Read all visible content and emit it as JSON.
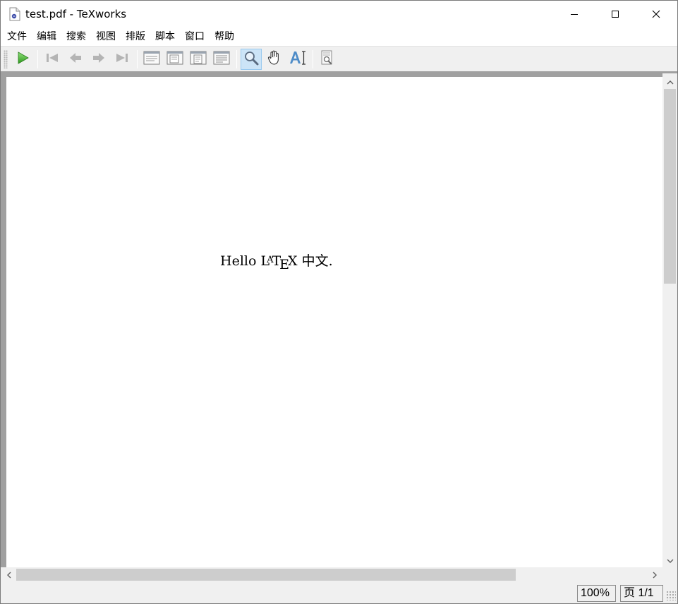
{
  "window": {
    "title": "test.pdf - TeXworks",
    "app_icon": "pdf-document-icon"
  },
  "window_controls": {
    "minimize_icon": "minimize-icon",
    "maximize_icon": "maximize-icon",
    "close_icon": "close-icon"
  },
  "menu": {
    "items": [
      "文件",
      "编辑",
      "搜索",
      "视图",
      "排版",
      "脚本",
      "窗口",
      "帮助"
    ]
  },
  "toolbar": {
    "typeset_icon": "play-icon",
    "first_page_icon": "first-page-icon",
    "prev_page_icon": "previous-page-icon",
    "next_page_icon": "next-page-icon",
    "last_page_icon": "last-page-icon",
    "actual_size_icon": "actual-size-icon",
    "fit_width_icon": "fit-width-icon",
    "fit_window_icon": "fit-window-icon",
    "fit_content_icon": "fit-content-icon",
    "magnify_icon": "magnifier-icon",
    "scroll_icon": "hand-icon",
    "select_text_icon": "text-select-icon",
    "goto_source_icon": "goto-source-icon",
    "active_tool": "magnify",
    "accent_color": "#cce4f7"
  },
  "document": {
    "text_prefix": "Hello ",
    "latex_logo": "LaTeX",
    "text_suffix": " 中文."
  },
  "status": {
    "zoom": "100%",
    "page": "页 1/1"
  }
}
